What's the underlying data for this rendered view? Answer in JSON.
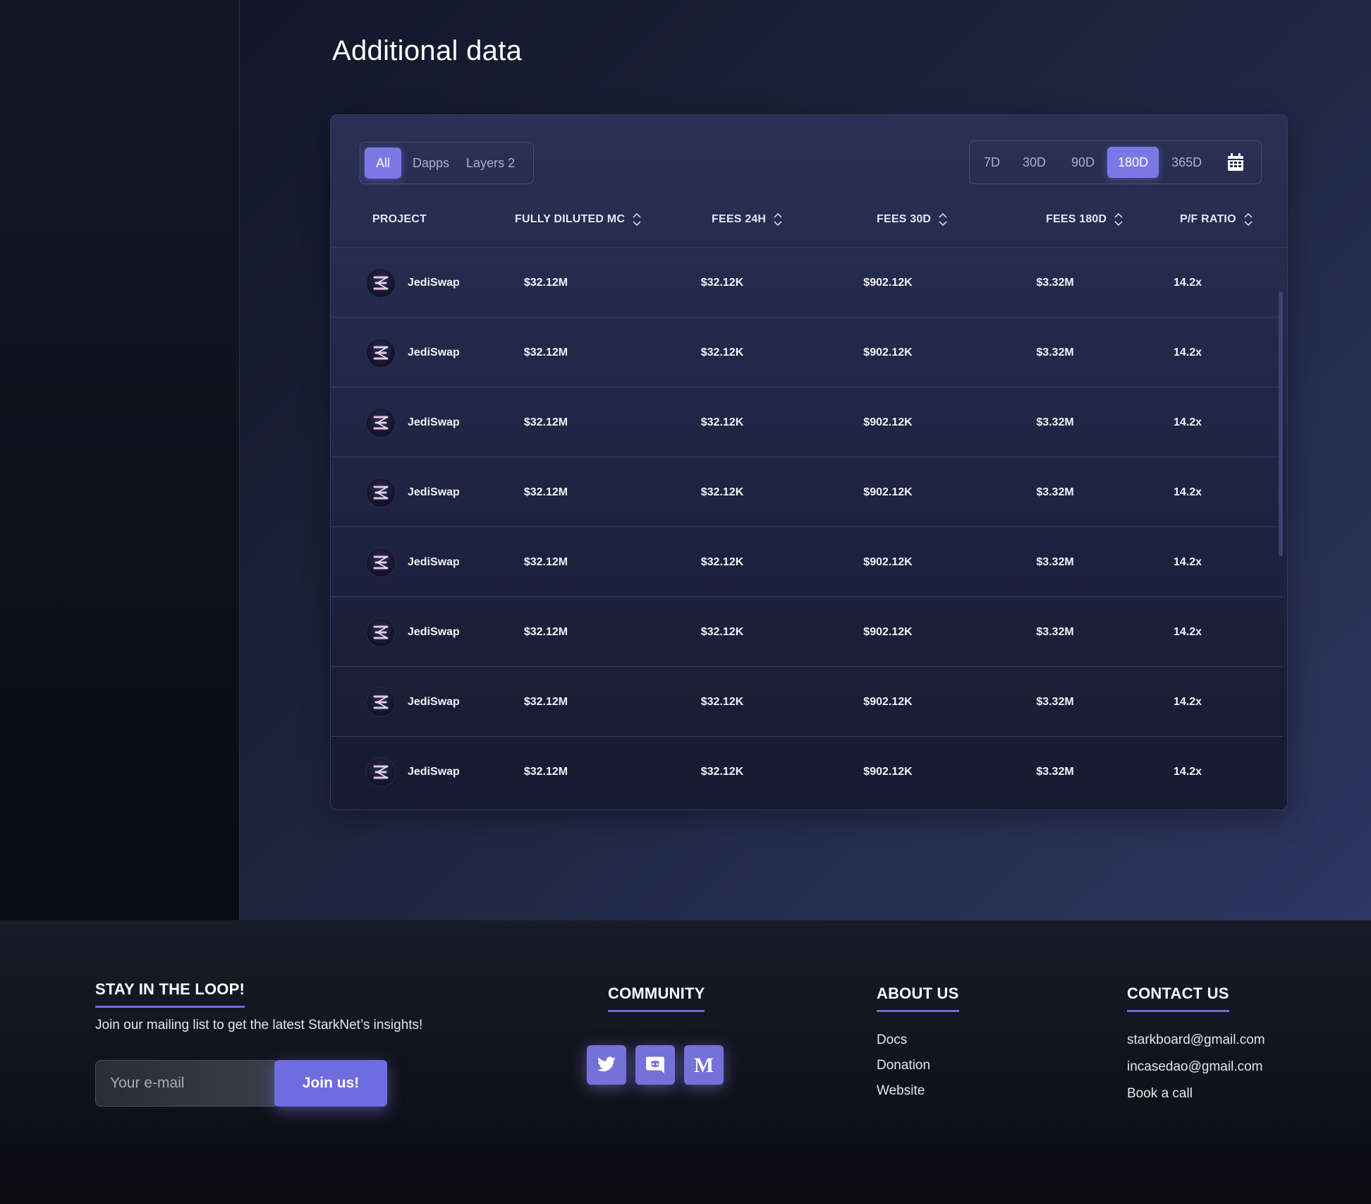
{
  "page": {
    "title": "Additional data"
  },
  "filters": {
    "category": [
      {
        "label": "All",
        "active": true
      },
      {
        "label": "Dapps",
        "active": false
      },
      {
        "label": "Layers 2",
        "active": false
      }
    ],
    "period": [
      {
        "label": "7D",
        "active": false
      },
      {
        "label": "30D",
        "active": false
      },
      {
        "label": "90D",
        "active": false
      },
      {
        "label": "180D",
        "active": true
      },
      {
        "label": "365D",
        "active": false
      }
    ],
    "calendar_icon": "calendar-icon"
  },
  "table": {
    "columns": [
      "PROJECT",
      "FULLY DILUTED MC",
      "FEES 24H",
      "FEES 30D",
      "FEES 180D",
      "P/F RATIO"
    ],
    "rows": [
      {
        "project": "JediSwap",
        "fdmc": "$32.12M",
        "fees24h": "$32.12K",
        "fees30d": "$902.12K",
        "fees180d": "$3.32M",
        "pf": "14.2x"
      },
      {
        "project": "JediSwap",
        "fdmc": "$32.12M",
        "fees24h": "$32.12K",
        "fees30d": "$902.12K",
        "fees180d": "$3.32M",
        "pf": "14.2x"
      },
      {
        "project": "JediSwap",
        "fdmc": "$32.12M",
        "fees24h": "$32.12K",
        "fees30d": "$902.12K",
        "fees180d": "$3.32M",
        "pf": "14.2x"
      },
      {
        "project": "JediSwap",
        "fdmc": "$32.12M",
        "fees24h": "$32.12K",
        "fees30d": "$902.12K",
        "fees180d": "$3.32M",
        "pf": "14.2x"
      },
      {
        "project": "JediSwap",
        "fdmc": "$32.12M",
        "fees24h": "$32.12K",
        "fees30d": "$902.12K",
        "fees180d": "$3.32M",
        "pf": "14.2x"
      },
      {
        "project": "JediSwap",
        "fdmc": "$32.12M",
        "fees24h": "$32.12K",
        "fees30d": "$902.12K",
        "fees180d": "$3.32M",
        "pf": "14.2x"
      },
      {
        "project": "JediSwap",
        "fdmc": "$32.12M",
        "fees24h": "$32.12K",
        "fees30d": "$902.12K",
        "fees180d": "$3.32M",
        "pf": "14.2x"
      },
      {
        "project": "JediSwap",
        "fdmc": "$32.12M",
        "fees24h": "$32.12K",
        "fees30d": "$902.12K",
        "fees180d": "$3.32M",
        "pf": "14.2x"
      }
    ]
  },
  "footer": {
    "newsletter": {
      "heading": "STAY IN THE LOOP!",
      "text": "Join our mailing list to get the latest StarkNet’s insights!",
      "placeholder": "Your e-mail",
      "button": "Join us!"
    },
    "community": {
      "heading": "COMMUNITY",
      "icons": [
        "twitter-icon",
        "discord-icon",
        "medium-icon"
      ]
    },
    "about": {
      "heading": "ABOUT US",
      "links": [
        "Docs",
        "Donation",
        "Website"
      ]
    },
    "contact": {
      "heading": "CONTACT US",
      "links": [
        "starkboard@gmail.com",
        "incasedao@gmail.com",
        "Book a call"
      ]
    }
  },
  "colors": {
    "accent": "#7b78e6",
    "background": "#1a2036",
    "footer": "#111219"
  }
}
